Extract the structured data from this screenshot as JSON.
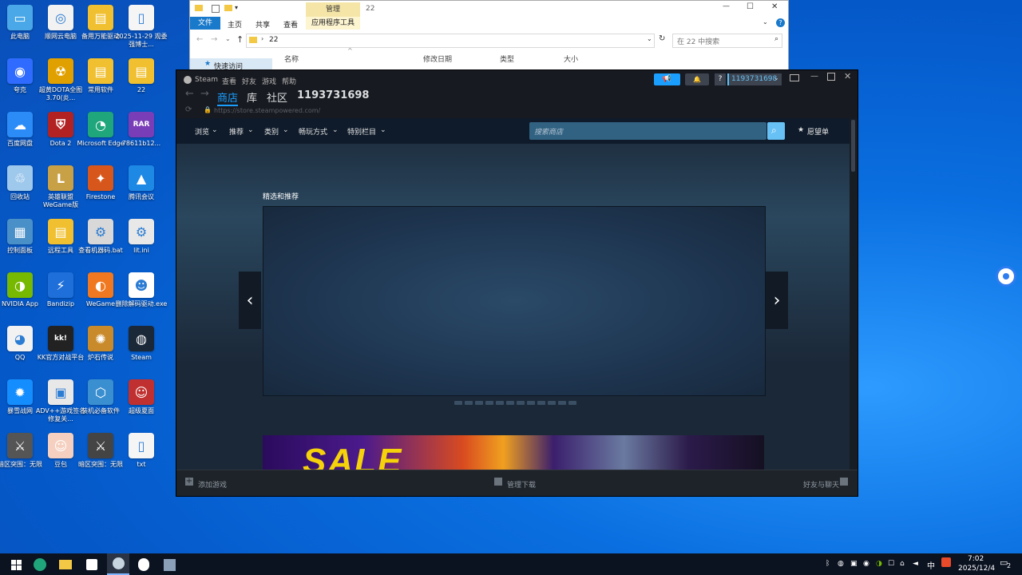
{
  "desktop": {
    "icons": [
      {
        "label": "此电脑",
        "glyph": "▭",
        "color": "#4aa8e8"
      },
      {
        "label": "顺网云电脑",
        "glyph": "◎",
        "color": "#f2f2f2"
      },
      {
        "label": "备用万能驱动",
        "glyph": "▤",
        "color": "#f0c030"
      },
      {
        "label": "2025-11-29 观委强博士...",
        "glyph": "▯",
        "color": "#f5f5f5"
      },
      {
        "label": "夸克",
        "glyph": "◉",
        "color": "#2f6bff"
      },
      {
        "label": "超黄DOTA全图3.70(炎...",
        "glyph": "☢",
        "color": "#e0a000"
      },
      {
        "label": "常用软件",
        "glyph": "▤",
        "color": "#f0c030"
      },
      {
        "label": "22",
        "glyph": "▤",
        "color": "#f0c030"
      },
      {
        "label": "百度网盘",
        "glyph": "☁",
        "color": "#2b8cf7"
      },
      {
        "label": "Dota 2",
        "glyph": "⛨",
        "color": "#b22222"
      },
      {
        "label": "Microsoft Edge",
        "glyph": "◔",
        "color": "#1fa67a"
      },
      {
        "label": "78611b12...",
        "glyph": "RAR",
        "color": "#7a3db8"
      },
      {
        "label": "回收站",
        "glyph": "♲",
        "color": "#9ec8ec"
      },
      {
        "label": "英雄联盟 WeGame版",
        "glyph": "L",
        "color": "#c8a045"
      },
      {
        "label": "Firestone",
        "glyph": "✦",
        "color": "#d7561b"
      },
      {
        "label": "腾讯会议",
        "glyph": "▲",
        "color": "#1e88e5"
      },
      {
        "label": "控制面板",
        "glyph": "▦",
        "color": "#4a90c8"
      },
      {
        "label": "远程工具",
        "glyph": "▤",
        "color": "#f0c030"
      },
      {
        "label": "查看机器码.bat",
        "glyph": "⚙",
        "color": "#d8d8d8"
      },
      {
        "label": "lit.ini",
        "glyph": "⚙",
        "color": "#e8e8e8"
      },
      {
        "label": "NVIDIA App",
        "glyph": "◑",
        "color": "#76b900"
      },
      {
        "label": "Bandizip",
        "glyph": "⚡",
        "color": "#1e6fd9"
      },
      {
        "label": "WeGame",
        "glyph": "◐",
        "color": "#f07820"
      },
      {
        "label": "删除解码驱动.exe",
        "glyph": "☻",
        "color": "#ffffff"
      },
      {
        "label": "QQ",
        "glyph": "◕",
        "color": "#f2f2f2"
      },
      {
        "label": "KK官方对战平台",
        "glyph": "kk!",
        "color": "#222222"
      },
      {
        "label": "炉石传说",
        "glyph": "✺",
        "color": "#c88a2a"
      },
      {
        "label": "Steam",
        "glyph": "◍",
        "color": "#1b2838"
      },
      {
        "label": "暴雪战网",
        "glyph": "✹",
        "color": "#148eff"
      },
      {
        "label": "ADV++游戏签名修复关...",
        "glyph": "▣",
        "color": "#e8e8e8"
      },
      {
        "label": "装机必备软件",
        "glyph": "⬡",
        "color": "#3a8fd0"
      },
      {
        "label": "超级夏面",
        "glyph": "☺",
        "color": "#c03030"
      },
      {
        "label": "暗区突围：无限",
        "glyph": "⚔",
        "color": "#555555"
      },
      {
        "label": "豆包",
        "glyph": "☺",
        "color": "#f5d0c0"
      },
      {
        "label": "暗区突围：无限",
        "glyph": "⚔",
        "color": "#444444"
      },
      {
        "label": "txt",
        "glyph": "▯",
        "color": "#f5f5f5"
      }
    ]
  },
  "explorer": {
    "context_tab": "管理",
    "title": "22",
    "tabs": [
      "文件",
      "主页",
      "共享",
      "查看",
      "应用程序工具"
    ],
    "path": "22",
    "search_placeholder": "在 22 中搜索",
    "columns": [
      "名称",
      "修改日期",
      "类型",
      "大小"
    ],
    "sidebar_item": "快速访问",
    "controls": {
      "minimize": "—",
      "maximize": "☐",
      "close": "✕"
    }
  },
  "steam": {
    "menu": [
      "Steam",
      "查看",
      "好友",
      "游戏",
      "帮助"
    ],
    "nav": [
      "商店",
      "库",
      "社区",
      "1193731698"
    ],
    "url": "https://store.steampowered.com/",
    "account": "1193731698",
    "help_icon": "?",
    "subnav": [
      "浏览",
      "推荐",
      "类别",
      "畅玩方式",
      "特别栏目"
    ],
    "search_placeholder": "搜索商店",
    "wishlist": "愿望单",
    "featured_title": "精选和推荐",
    "banner_text": "SALE",
    "bottom": {
      "add_game": "添加游戏",
      "manage_downloads": "管理下载",
      "friends_chat": "好友与聊天"
    }
  },
  "taskbar": {
    "ime": "中",
    "time": "7:02",
    "date": "2025/12/4",
    "notification_count": "2"
  }
}
